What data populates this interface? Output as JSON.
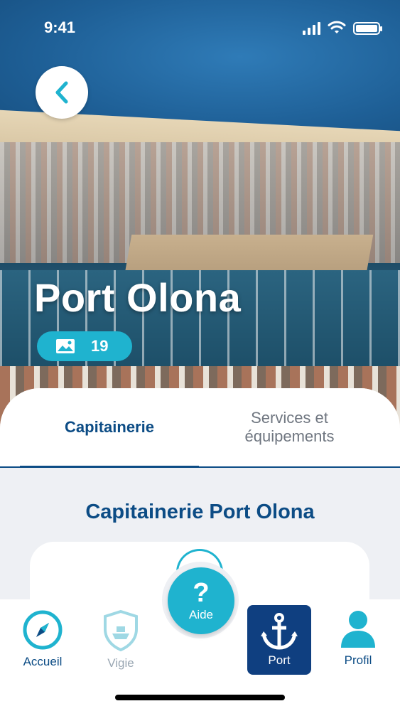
{
  "status_bar": {
    "time": "9:41"
  },
  "hero": {
    "title": "Port Olona",
    "photo_count": "19"
  },
  "tabs": [
    {
      "label": "Capitainerie",
      "active": true
    },
    {
      "label": "Services et équipements",
      "active": false
    }
  ],
  "section": {
    "title": "Capitainerie Port Olona"
  },
  "help_button": {
    "symbol": "?",
    "label": "Aide"
  },
  "nav": {
    "items": [
      {
        "label": "Accueil",
        "icon": "compass-icon"
      },
      {
        "label": "Vigie",
        "icon": "shield-boat-icon"
      },
      {
        "label": "Port",
        "icon": "anchor-icon",
        "active": true
      },
      {
        "label": "Profil",
        "icon": "person-icon"
      }
    ]
  },
  "colors": {
    "primary": "#0c4c85",
    "accent": "#1fb3cf",
    "nav_active_bg": "#0f3f80",
    "muted": "#6f7680"
  }
}
